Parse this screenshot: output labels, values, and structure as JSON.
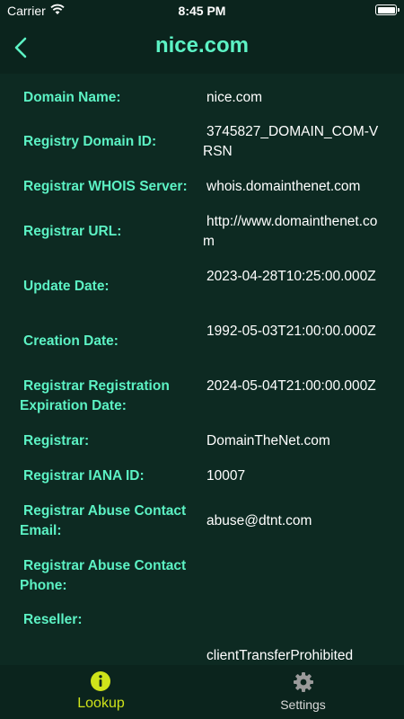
{
  "status_bar": {
    "carrier": "Carrier",
    "time": "8:45 PM"
  },
  "header": {
    "title": "nice.com"
  },
  "records": [
    {
      "label": "Domain Name:",
      "value": "nice.com"
    },
    {
      "label": "Registry Domain ID:",
      "value": "3745827_DOMAIN_COM-VRSN"
    },
    {
      "label": "Registrar WHOIS Server:",
      "value": "whois.domainthenet.com"
    },
    {
      "label": "Registrar URL:",
      "value": "http://www.domainthenet.com"
    },
    {
      "label": "Update Date:",
      "value": "2023-04-28T10:25:00.000Z"
    },
    {
      "label": "Creation Date:",
      "value": "1992-05-03T21:00:00.000Z"
    },
    {
      "label": "Registrar Registration Expiration Date:",
      "value": "2024-05-04T21:00:00.000Z"
    },
    {
      "label": "Registrar:",
      "value": "DomainTheNet.com"
    },
    {
      "label": "Registrar IANA ID:",
      "value": "10007"
    },
    {
      "label": "Registrar Abuse Contact Email:",
      "value": "abuse@dtnt.com"
    },
    {
      "label": "Registrar Abuse Contact Phone:",
      "value": ""
    },
    {
      "label": "Reseller:",
      "value": ""
    },
    {
      "label": "",
      "value": "clientTransferProhibited"
    }
  ],
  "tabs": [
    {
      "label": "Lookup",
      "icon": "info-icon",
      "active": true
    },
    {
      "label": "Settings",
      "icon": "gear-icon",
      "active": false
    }
  ],
  "colors": {
    "accent": "#5cf2c4",
    "active_tab": "#cfe31a",
    "background": "#0d2a22",
    "bar": "#0b241d"
  }
}
